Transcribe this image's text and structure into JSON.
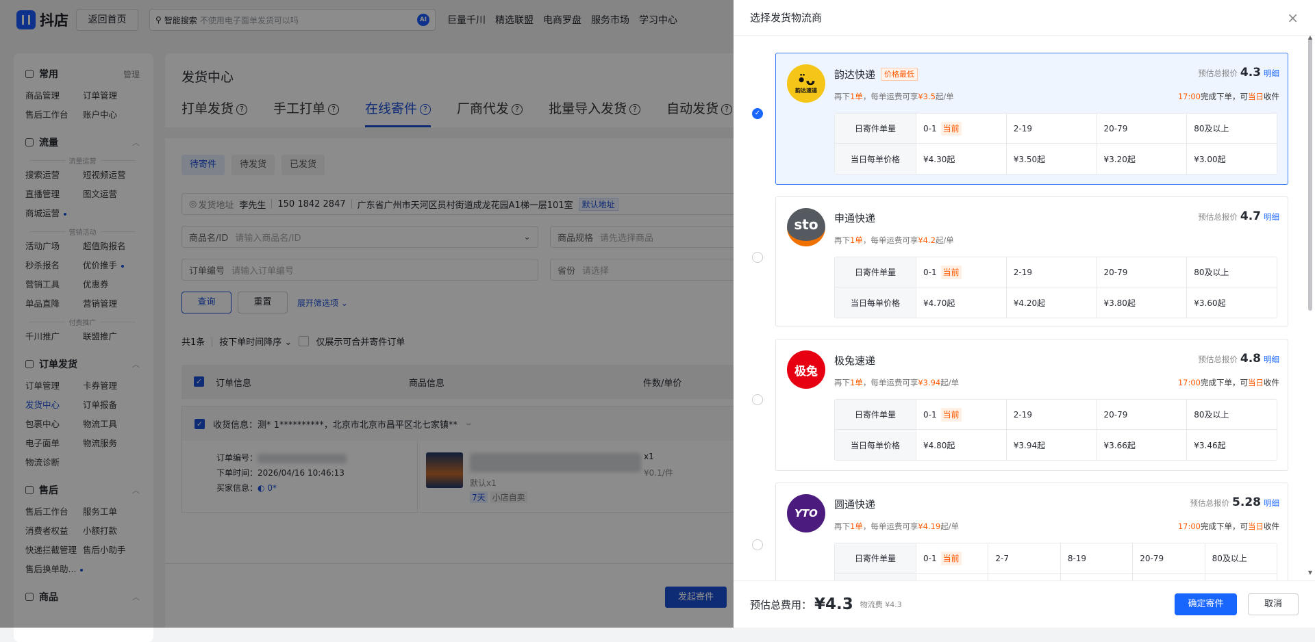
{
  "topbar": {
    "logo": "抖店",
    "home": "返回首页",
    "search_label": "智能搜索",
    "search_placeholder": "不使用电子面单发货可以吗",
    "ai": "AI",
    "nav": [
      "巨量千川",
      "精选联盟",
      "电商罗盘",
      "服务市场",
      "学习中心"
    ]
  },
  "sidebar": {
    "sections": [
      {
        "title": "常用",
        "action": "管理",
        "groups": [
          {
            "label": "",
            "items": [
              {
                "label": "商品管理"
              },
              {
                "label": "订单管理"
              },
              {
                "label": "售后工作台"
              },
              {
                "label": "账户中心"
              }
            ]
          }
        ]
      },
      {
        "title": "流量",
        "groups": [
          {
            "label": "流量运营",
            "items": [
              {
                "label": "搜索运营"
              },
              {
                "label": "短视频运营"
              },
              {
                "label": "直播管理"
              },
              {
                "label": "图文运营"
              },
              {
                "label": "商城运营",
                "dot": true
              }
            ]
          },
          {
            "label": "营销活动",
            "items": [
              {
                "label": "活动广场"
              },
              {
                "label": "超值购报名"
              },
              {
                "label": "秒杀报名"
              },
              {
                "label": "优价推手",
                "dot": true
              },
              {
                "label": "营销工具"
              },
              {
                "label": "优惠券"
              },
              {
                "label": "单品直降"
              },
              {
                "label": "营销管理"
              }
            ]
          },
          {
            "label": "付费推广",
            "items": [
              {
                "label": "千川推广"
              },
              {
                "label": "联盟推广"
              }
            ]
          }
        ]
      },
      {
        "title": "订单发货",
        "groups": [
          {
            "label": "",
            "items": [
              {
                "label": "订单管理"
              },
              {
                "label": "卡券管理"
              },
              {
                "label": "发货中心",
                "active": true
              },
              {
                "label": "订单报备"
              },
              {
                "label": "包裹中心"
              },
              {
                "label": "物流工具"
              },
              {
                "label": "电子面单"
              },
              {
                "label": "物流服务"
              },
              {
                "label": "物流诊断"
              }
            ]
          }
        ]
      },
      {
        "title": "售后",
        "groups": [
          {
            "label": "",
            "items": [
              {
                "label": "售后工作台"
              },
              {
                "label": "服务工单"
              },
              {
                "label": "消费者权益"
              },
              {
                "label": "小额打款"
              },
              {
                "label": "快递拦截管理"
              },
              {
                "label": "售后小助手"
              },
              {
                "label": "售后换单助...",
                "dot": true
              }
            ]
          }
        ]
      },
      {
        "title": "商品",
        "groups": []
      }
    ]
  },
  "main": {
    "title": "发货中心",
    "tabs": [
      "打单发货",
      "手工打单",
      "在线寄件",
      "厂商代发",
      "批量导入发货",
      "自动发货"
    ],
    "active_tab": 2,
    "subtabs": [
      "待寄件",
      "待发货",
      "已发货"
    ],
    "address": {
      "label": "发货地址",
      "name": "李先生",
      "phone": "150 1842 2847",
      "addr": "广东省广州市天河区员村街道成龙花园A1梯一层101室",
      "tag": "默认地址"
    },
    "filters": [
      {
        "label": "商品名/ID",
        "placeholder": "请输入商品名/ID"
      },
      {
        "label": "商品规格",
        "placeholder": "请先选择商品"
      },
      {
        "label": "订单编号",
        "placeholder": "请输入订单编号"
      },
      {
        "label": "省份",
        "placeholder": "请选择"
      }
    ],
    "query": "查询",
    "reset": "重置",
    "expand": "展开筛选项 ⌄",
    "count": "共1条",
    "sort": "按下单时间降序 ⌄",
    "merge_only": "仅展示可合并寄件订单",
    "table_headers": [
      "订单信息",
      "商品信息",
      "件数/单价"
    ],
    "order": {
      "receiver": "收货信息：测* 1**********，北京市北京市昌平区北七家镇**",
      "order_no_label": "订单编号：",
      "time_label": "下单时间：",
      "time": "2026/04/16 10:46:13",
      "buyer_label": "买家信息：",
      "buyer": "0*",
      "spec": "默认x1",
      "tags": [
        "7天",
        "小店自卖"
      ],
      "qty": "x1",
      "unit_price": "¥0.1/件"
    },
    "submit": "发起寄件"
  },
  "drawer": {
    "title": "选择发货物流商",
    "close": "×",
    "quote_label": "预估总报价",
    "detail": "明细",
    "row1_label": "日寄件单量",
    "row2_label": "当日每单价格",
    "current_tag": "当前",
    "carriers": [
      {
        "name": "韵达快递",
        "badge": "价格最低",
        "logo": "韵达速递",
        "quote": "4.3",
        "promo_n": "1单",
        "promo_price": "¥3.5",
        "cutoff": true,
        "selected": true,
        "ranges": [
          "0-1",
          "2-19",
          "20-79",
          "80及以上"
        ],
        "prices": [
          "¥4.30起",
          "¥3.50起",
          "¥3.20起",
          "¥3.00起"
        ]
      },
      {
        "name": "申通快递",
        "logo": "sto",
        "quote": "4.7",
        "promo_n": "1单",
        "promo_price": "¥4.2",
        "cutoff": false,
        "ranges": [
          "0-1",
          "2-19",
          "20-79",
          "80及以上"
        ],
        "prices": [
          "¥4.70起",
          "¥4.20起",
          "¥3.80起",
          "¥3.60起"
        ]
      },
      {
        "name": "极兔速递",
        "logo": "极兔",
        "quote": "4.8",
        "promo_n": "1单",
        "promo_price": "¥3.94",
        "cutoff": true,
        "ranges": [
          "0-1",
          "2-19",
          "20-79",
          "80及以上"
        ],
        "prices": [
          "¥4.80起",
          "¥3.94起",
          "¥3.66起",
          "¥3.46起"
        ]
      },
      {
        "name": "圆通快递",
        "logo": "YTO",
        "quote": "5.28",
        "promo_n": "1单",
        "promo_price": "¥4.19",
        "cutoff": true,
        "ranges": [
          "0-1",
          "2-7",
          "8-19",
          "20-79",
          "80及以上"
        ],
        "prices": [
          "",
          "",
          "",
          "",
          ""
        ]
      }
    ],
    "promo_prefix": "再下",
    "promo_mid": "，每单运费可享",
    "promo_suffix": "起/单",
    "cutoff_time": "17:00",
    "cutoff_mid": "完成下单，可",
    "cutoff_day": "当日",
    "cutoff_suffix": "收件",
    "footer": {
      "total_label": "预估总费用：",
      "total": "¥4.3",
      "fee": "物流费 ¥4.3",
      "confirm": "确定寄件",
      "cancel": "取消"
    }
  },
  "colors": {
    "accent": "#1966ff",
    "page_blue": "#1a4fd6",
    "orange": "#ff5a00",
    "yunda": "#f5c518",
    "sto": "#555a60",
    "jitu": "#e60012",
    "yto": "#4b1c7d"
  }
}
